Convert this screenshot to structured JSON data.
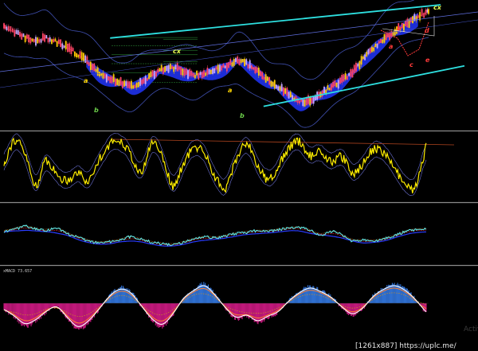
{
  "colors": {
    "background": "#000000",
    "divider": "#9a9a9a",
    "candle_up": "#ff4466",
    "candle_down": "#ffcc00",
    "candle_neutral": "#c8a8ff",
    "channel": "#2ee0e0",
    "cloud": "#1d2fe0",
    "envelope": "#3f4fb0",
    "fib": "#2f9a3a",
    "wave_a": "#ffd700",
    "wave_b": "#6cd04a",
    "wave_cx": "#e8ff50",
    "wave_red": "#ff3a3a",
    "stoch_main": "#ffee00",
    "stoch_env": "#6a6fd0",
    "stoch_trend": "#b2451f",
    "ma_cyan": "#5ce6e6",
    "ma_blue": "#2a3cff",
    "ma_red": "#c0202a",
    "ma_orange": "#c8741f",
    "macd_pos": "#2f6fd0",
    "macd_neg": "#c0187a",
    "macd_line": "#ffffff",
    "macd_signal": "#ff8030",
    "macd_dotted": "#d09020"
  },
  "labels": {
    "macd_indicator": "xMACD 73.657",
    "watermark": "[1261x887] https://uplc.me/",
    "activation": "Activ"
  },
  "waves": [
    {
      "text": "a",
      "color": "wave_a"
    },
    {
      "text": "b",
      "color": "wave_b"
    },
    {
      "text": "cx",
      "color": "wave_cx"
    },
    {
      "text": "a",
      "color": "wave_a"
    },
    {
      "text": "b",
      "color": "wave_b"
    },
    {
      "text": "a",
      "color": "wave_red"
    },
    {
      "text": "b",
      "color": "wave_red"
    },
    {
      "text": "c",
      "color": "wave_red"
    },
    {
      "text": "d",
      "color": "wave_red"
    },
    {
      "text": "e",
      "color": "wave_red"
    },
    {
      "text": "cx",
      "color": "wave_cx"
    }
  ],
  "chart_data": [
    {
      "type": "candlestick",
      "panel": "price",
      "x": [
        0,
        1,
        2,
        3,
        4,
        5,
        6,
        7,
        8,
        9,
        10,
        11,
        12,
        13,
        14,
        15,
        16,
        17,
        18,
        19,
        20,
        21,
        22,
        23,
        24,
        25,
        26,
        27,
        28,
        29,
        30,
        31,
        32,
        33,
        34,
        35,
        36,
        37,
        38,
        39,
        40
      ],
      "close": [
        83,
        78,
        74,
        71,
        73,
        69,
        64,
        58,
        50,
        42,
        37,
        33,
        30,
        34,
        40,
        45,
        46,
        43,
        40,
        42,
        45,
        48,
        53,
        49,
        42,
        34,
        28,
        22,
        16,
        18,
        24,
        30,
        36,
        44,
        56,
        66,
        73,
        80,
        86,
        92,
        97
      ],
      "channel_upper": {
        "x": [
          10,
          40
        ],
        "y": [
          73,
          100
        ]
      },
      "channel_lower": {
        "x": [
          24,
          40
        ],
        "y": [
          16,
          48
        ]
      }
    },
    {
      "type": "line",
      "panel": "stochastic",
      "x": [
        0,
        1,
        2,
        3,
        4,
        5,
        6,
        7,
        8,
        9,
        10,
        11,
        12,
        13,
        14,
        15,
        16,
        17,
        18,
        19,
        20,
        21,
        22,
        23,
        24,
        25,
        26,
        27,
        28,
        29,
        30,
        31,
        32,
        33,
        34,
        35,
        36,
        37,
        38,
        39,
        40
      ],
      "series": [
        {
          "values": [
            55,
            92,
            70,
            22,
            60,
            38,
            30,
            42,
            28,
            62,
            85,
            92,
            70,
            40,
            88,
            68,
            20,
            55,
            80,
            72,
            35,
            18,
            62,
            88,
            54,
            30,
            52,
            80,
            90,
            68,
            74,
            58,
            66,
            40,
            56,
            78,
            72,
            48,
            22,
            20,
            84
          ]
        }
      ],
      "ylim": [
        0,
        100
      ]
    },
    {
      "type": "line",
      "panel": "moving_averages",
      "x": [
        0,
        1,
        2,
        3,
        4,
        5,
        6,
        7,
        8,
        9,
        10,
        11,
        12,
        13,
        14,
        15,
        16,
        17,
        18,
        19,
        20,
        21,
        22,
        23,
        24,
        25,
        26,
        27,
        28,
        29,
        30,
        31,
        32,
        33,
        34,
        35,
        36,
        37,
        38,
        39,
        40
      ],
      "series": [
        {
          "values": [
            55,
            60,
            66,
            62,
            58,
            63,
            52,
            46,
            38,
            35,
            37,
            40,
            46,
            42,
            36,
            33,
            32,
            36,
            42,
            46,
            44,
            48,
            52,
            54,
            58,
            56,
            60,
            62,
            64,
            58,
            50,
            56,
            50,
            38,
            40,
            38,
            42,
            48,
            56,
            60,
            63
          ]
        }
      ],
      "ylim": [
        0,
        100
      ]
    },
    {
      "type": "bar",
      "panel": "macd",
      "title": "xMACD 73.657",
      "x": [
        0,
        1,
        2,
        3,
        4,
        5,
        6,
        7,
        8,
        9,
        10,
        11,
        12,
        13,
        14,
        15,
        16,
        17,
        18,
        19,
        20,
        21,
        22,
        23,
        24,
        25,
        26,
        27,
        28,
        29,
        30,
        31,
        32,
        33,
        34,
        35,
        36,
        37,
        38,
        39,
        40
      ],
      "values": [
        -10,
        -22,
        -35,
        -28,
        -14,
        -6,
        -24,
        -40,
        -30,
        -10,
        12,
        24,
        18,
        -4,
        -26,
        -36,
        -18,
        8,
        22,
        30,
        14,
        -8,
        -24,
        -20,
        -30,
        -22,
        -14,
        4,
        18,
        26,
        20,
        10,
        -6,
        -18,
        -8,
        12,
        24,
        30,
        22,
        6,
        -16
      ],
      "ylim": [
        -50,
        50
      ]
    }
  ]
}
